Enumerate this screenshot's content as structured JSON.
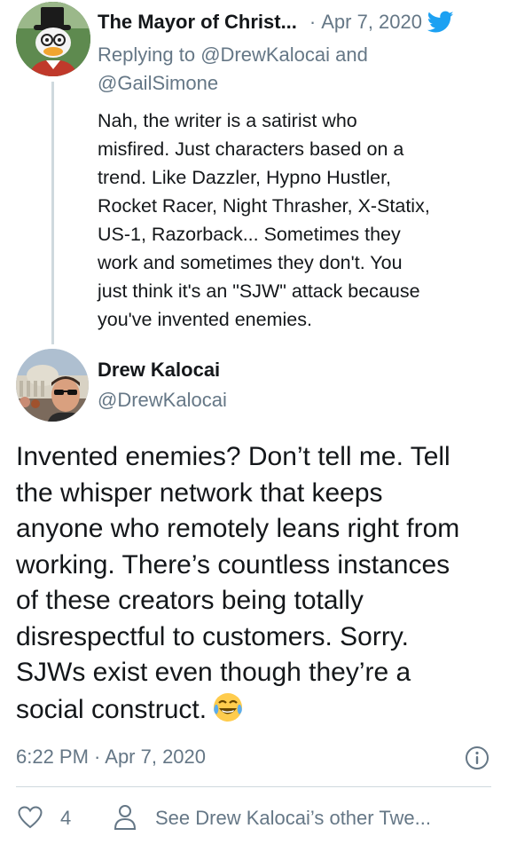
{
  "parent_tweet": {
    "display_name": "The Mayor of Christ...",
    "separator": "·",
    "date": "Apr 7, 2020",
    "reply_prefix": "Replying to",
    "reply_to_1": "@DrewKalocai",
    "reply_and": "and",
    "reply_to_2": "@GailSimone",
    "text_lines": [
      "Nah, the writer is a satirist who",
      "misfired. Just characters based on a",
      "trend. Like Dazzler, Hypno Hustler,",
      "Rocket Racer, Night Thrasher, X-Statix,",
      "US-1, Razorback... Sometimes they",
      "work and sometimes they don't. You",
      "just think it's an \"SJW\" attack because",
      "you've invented enemies."
    ],
    "avatar_icon": "cartoon-duck-avatar"
  },
  "main_tweet": {
    "display_name": "Drew Kalocai",
    "handle": "@DrewKalocai",
    "avatar_icon": "man-sunglasses-photo-avatar",
    "text_lines": [
      "Invented enemies? Don’t tell me. Tell",
      "the whisper network that keeps",
      "anyone who remotely leans right from",
      "working. There’s countless instances",
      "of these creators being totally",
      "disrespectful to customers. Sorry.",
      "SJWs exist even though they’re a",
      "social construct."
    ],
    "emoji": "face-with-tears-of-joy",
    "timestamp": "6:22 PM · Apr 7, 2020",
    "likes": "4",
    "see_more": "See Drew Kalocai’s other Twe..."
  },
  "colors": {
    "twitter_blue": "#1da1f2",
    "secondary_text": "#657786",
    "primary_text": "#14171a",
    "divider": "#cfd9de"
  }
}
